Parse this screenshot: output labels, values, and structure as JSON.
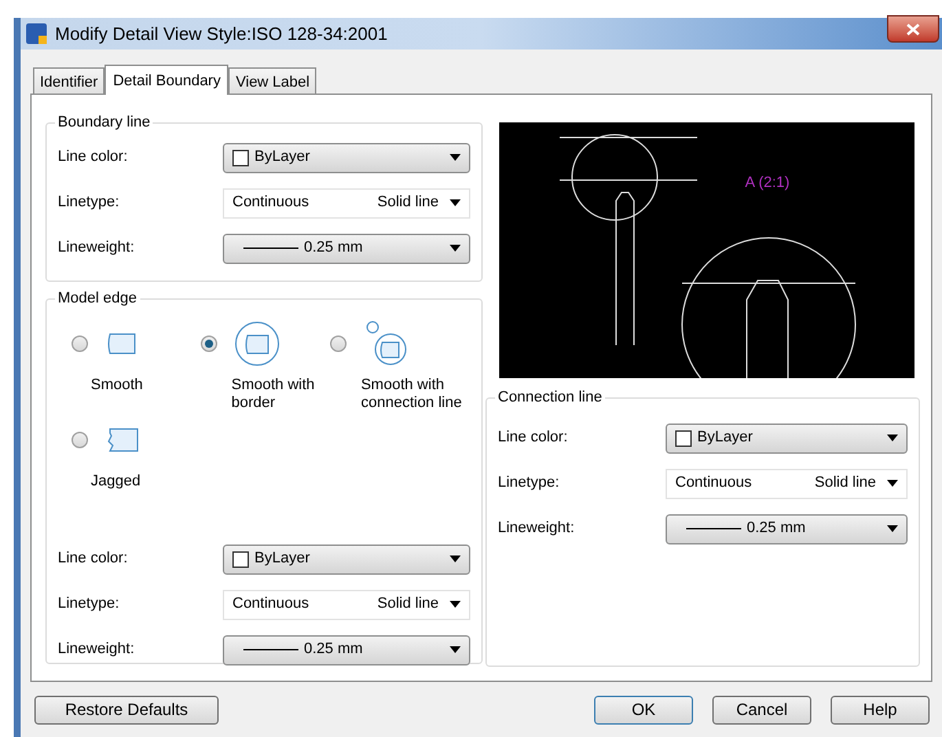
{
  "window": {
    "title": "Modify Detail View Style:ISO 128-34:2001"
  },
  "tabs": [
    {
      "label": "Identifier",
      "selected": false
    },
    {
      "label": "Detail Boundary",
      "selected": true
    },
    {
      "label": "View Label",
      "selected": false
    }
  ],
  "boundary_line": {
    "title": "Boundary line",
    "fields": [
      {
        "kind": "color",
        "label": "Line color:",
        "value": "ByLayer"
      },
      {
        "kind": "linetype",
        "label": "Linetype:",
        "value": "Continuous",
        "description": "Solid line"
      },
      {
        "kind": "lineweight",
        "label": "Lineweight:",
        "value": "0.25 mm"
      }
    ]
  },
  "model_edge": {
    "title": "Model edge",
    "options": [
      {
        "kind": "smooth",
        "label": "Smooth",
        "selected": false
      },
      {
        "kind": "smooth_border",
        "label": "Smooth with border",
        "selected": true
      },
      {
        "kind": "smooth_connection",
        "label": "Smooth with connection line",
        "selected": false
      },
      {
        "kind": "jagged",
        "label": "Jagged",
        "selected": false
      }
    ],
    "fields": [
      {
        "kind": "color",
        "label": "Line color:",
        "value": "ByLayer"
      },
      {
        "kind": "linetype",
        "label": "Linetype:",
        "value": "Continuous",
        "description": "Solid line"
      },
      {
        "kind": "lineweight",
        "label": "Lineweight:",
        "value": "0.25 mm"
      }
    ]
  },
  "preview": {
    "label": "A (2:1)"
  },
  "connection_line": {
    "title": "Connection line",
    "fields": [
      {
        "kind": "color",
        "label": "Line color:",
        "value": "ByLayer"
      },
      {
        "kind": "linetype",
        "label": "Linetype:",
        "value": "Continuous",
        "description": "Solid line"
      },
      {
        "kind": "lineweight",
        "label": "Lineweight:",
        "value": "0.25 mm"
      }
    ]
  },
  "buttons": [
    {
      "label": "Restore Defaults",
      "kind": "left",
      "default": false
    },
    {
      "label": "OK",
      "kind": "right",
      "default": true
    },
    {
      "label": "Cancel",
      "kind": "right",
      "default": false
    },
    {
      "label": "Help",
      "kind": "right",
      "default": false
    }
  ]
}
